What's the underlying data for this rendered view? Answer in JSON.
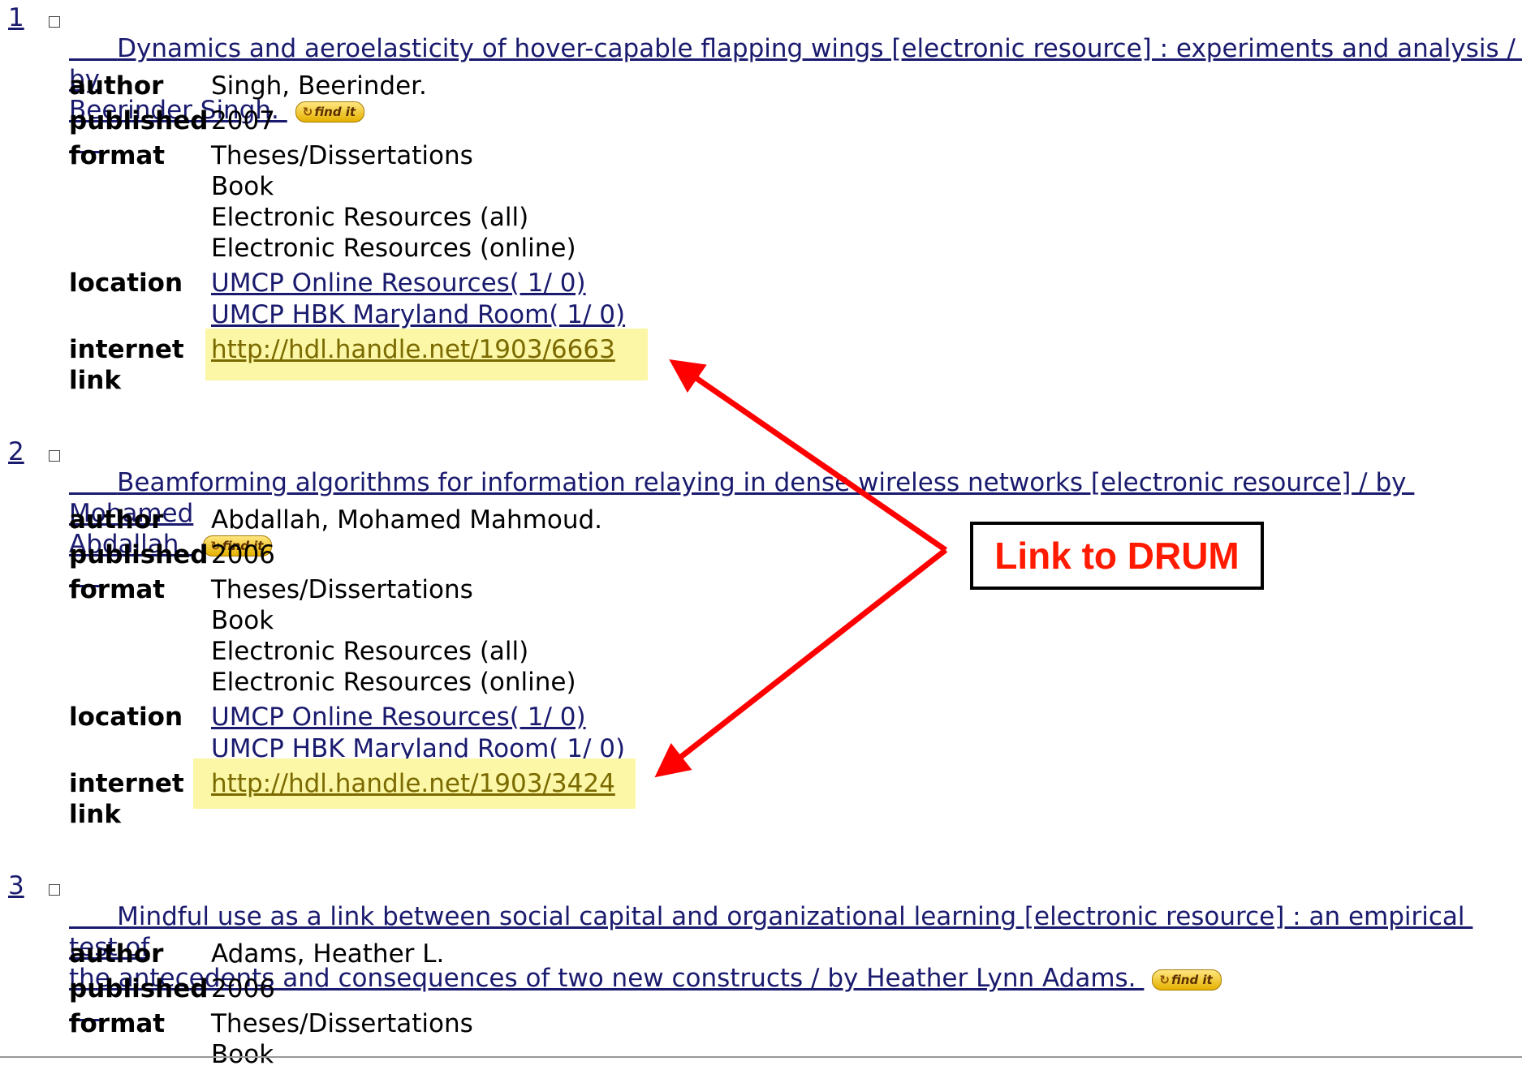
{
  "records": [
    {
      "number": "1",
      "title_line1": "Dynamics and aeroelasticity of hover-capable flapping wings [electronic resource] : experiments and analysis / by",
      "title_line2": "Beerinder Singh. ",
      "findit_label": "find it",
      "author": "Singh, Beerinder.",
      "published": "2007",
      "formats": [
        "Theses/Dissertations",
        "Book",
        "Electronic Resources (all)",
        "Electronic Resources (online)"
      ],
      "locations": [
        "UMCP Online Resources( 1/ 0)",
        "UMCP HBK Maryland Room( 1/ 0)"
      ],
      "internet_link": "http://hdl.handle.net/1903/6663"
    },
    {
      "number": "2",
      "title_line1": "Beamforming algorithms for information relaying in dense wireless networks [electronic resource] / by Mohamed",
      "title_line2": "Abdallah. ",
      "findit_label": "find it",
      "author": "Abdallah, Mohamed Mahmoud.",
      "published": "2006",
      "formats": [
        "Theses/Dissertations",
        "Book",
        "Electronic Resources (all)",
        "Electronic Resources (online)"
      ],
      "locations": [
        "UMCP Online Resources( 1/ 0)",
        "UMCP HBK Maryland Room( 1/ 0)"
      ],
      "internet_link": "http://hdl.handle.net/1903/3424"
    },
    {
      "number": "3",
      "title_line1": "Mindful use as a link between social capital and organizational learning [electronic resource] : an empirical test of",
      "title_line2": "the antecedents and consequences of two new constructs / by Heather Lynn Adams. ",
      "findit_label": "find it",
      "author": "Adams, Heather L.",
      "published": "2006",
      "formats": [
        "Theses/Dissertations",
        "Book"
      ]
    }
  ],
  "labels": {
    "author": "author",
    "published": "published",
    "format": "format",
    "location": "location",
    "internet": "internet",
    "link": "link"
  },
  "callout": "Link to DRUM",
  "colors": {
    "link": "#1a1a6e",
    "highlight": "#fbf7a6",
    "arrow": "#ff0000",
    "callout_text": "#ff1a00"
  }
}
